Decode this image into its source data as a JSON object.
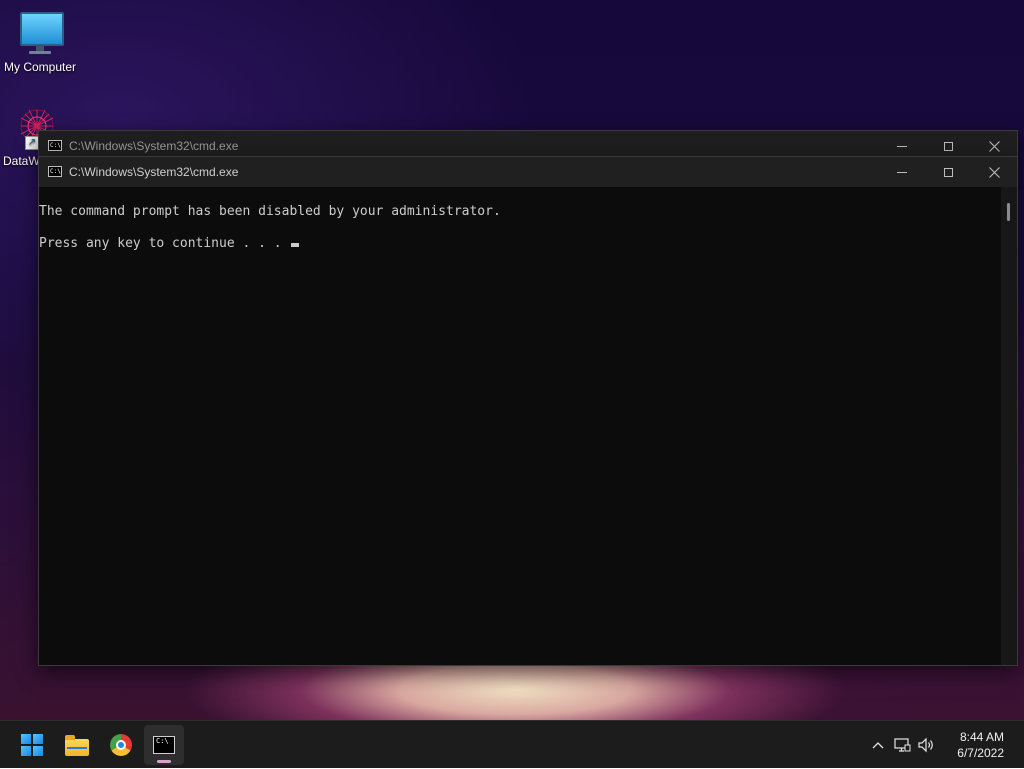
{
  "desktop": {
    "icons": [
      {
        "label": "My Computer",
        "icon": "monitor-icon"
      },
      {
        "label": "DataW",
        "icon": "datawave-icon"
      }
    ]
  },
  "windows": [
    {
      "title": "C:\\Windows\\System32\\cmd.exe",
      "state": "background"
    },
    {
      "title": "C:\\Windows\\System32\\cmd.exe",
      "state": "foreground",
      "console_lines": [
        "The command prompt has been disabled by your administrator.",
        "Press any key to continue . . . "
      ]
    }
  ],
  "title_icon_text": "C:\\",
  "taskbar": {
    "apps": [
      {
        "name": "start",
        "icon": "windows-logo-icon"
      },
      {
        "name": "file-explorer",
        "icon": "folder-icon"
      },
      {
        "name": "chrome",
        "icon": "chrome-icon"
      },
      {
        "name": "cmd",
        "icon": "cmd-icon",
        "active": true
      }
    ],
    "tray_icons": [
      "chevron-up-icon",
      "network-icon",
      "volume-icon"
    ],
    "clock": {
      "time": "8:44 AM",
      "date": "6/7/2022"
    }
  },
  "colors": {
    "console_bg": "#0c0c0c",
    "console_fg": "#cccccc",
    "titlebar": "#1f1f1f",
    "taskbar": "#1c1c1c",
    "active_indicator": "#d9a4d3"
  }
}
